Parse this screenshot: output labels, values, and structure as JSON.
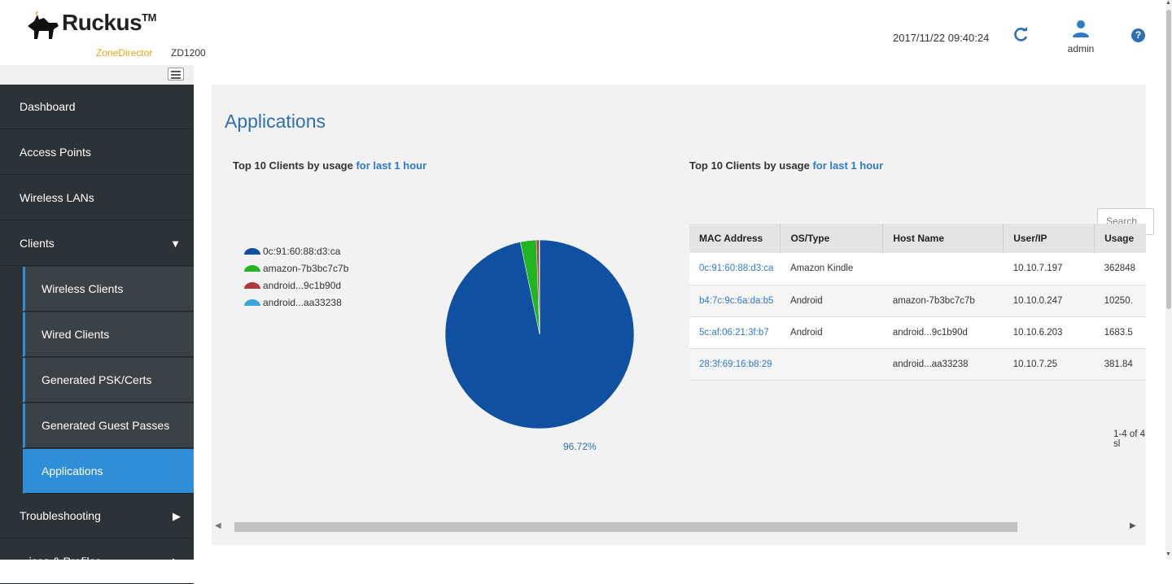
{
  "header": {
    "brand": "Ruckus",
    "trademark": "TM",
    "product": "ZoneDirector",
    "model": "ZD1200",
    "datetime": "2017/11/22  09:40:24",
    "user": "admin",
    "help_glyph": "?"
  },
  "sidebar": {
    "items": [
      {
        "label": "Dashboard"
      },
      {
        "label": "Access Points"
      },
      {
        "label": "Wireless LANs"
      },
      {
        "label": "Clients",
        "arrow": "▼"
      },
      {
        "label": "Wireless Clients"
      },
      {
        "label": "Wired Clients"
      },
      {
        "label": "Generated PSK/Certs"
      },
      {
        "label": "Generated Guest Passes"
      },
      {
        "label": "Applications"
      },
      {
        "label": "Troubleshooting",
        "arrow": "▶"
      },
      {
        "label": "...ices & Profiles",
        "arrow": "▶"
      }
    ]
  },
  "main": {
    "title": "Applications",
    "left_chart_title": {
      "prefix": "Top 10 Clients by usage ",
      "link": "for last 1 hour"
    },
    "right_chart_title": {
      "prefix": "Top 10 Clients by usage ",
      "link": "for last 1 hour"
    },
    "search_placeholder": "Search",
    "pager": "1-4 of 4 sl"
  },
  "chart_data": {
    "type": "pie",
    "series": [
      {
        "name": "0c:91:60:88:d3:ca",
        "value": 96.72,
        "color": "#1050a0"
      },
      {
        "name": "amazon-7b3bc7c7b",
        "value": 2.73,
        "color": "#22b522"
      },
      {
        "name": "android...9c1b90d",
        "value": 0.45,
        "color": "#b03a3a"
      },
      {
        "name": "android...aa33238",
        "value": 0.1,
        "color": "#3aa6d8"
      }
    ],
    "data_label": "96.72%",
    "legend_position": "left"
  },
  "table": {
    "columns": [
      "MAC Address",
      "OS/Type",
      "Host Name",
      "User/IP",
      "Usage"
    ],
    "rows": [
      [
        "0c:91:60:88:d3:ca",
        "Amazon Kindle",
        "",
        "10.10.7.197",
        "362848"
      ],
      [
        "b4:7c:9c:6a:da:b5",
        "Android",
        "amazon-7b3bc7c7b",
        "10.10.0.247",
        "10250."
      ],
      [
        "5c:af:06:21:3f:b7",
        "Android",
        "android...9c1b90d",
        "10.10.6.203",
        "1683.5"
      ],
      [
        "28:3f:69:16:b8:29",
        "",
        "android...aa33238",
        "10.10.7.25",
        "381.84"
      ]
    ]
  },
  "colors": {
    "accent": "#2f8fd8",
    "sidebar": "#2c3338",
    "title": "#2f6fb0"
  }
}
